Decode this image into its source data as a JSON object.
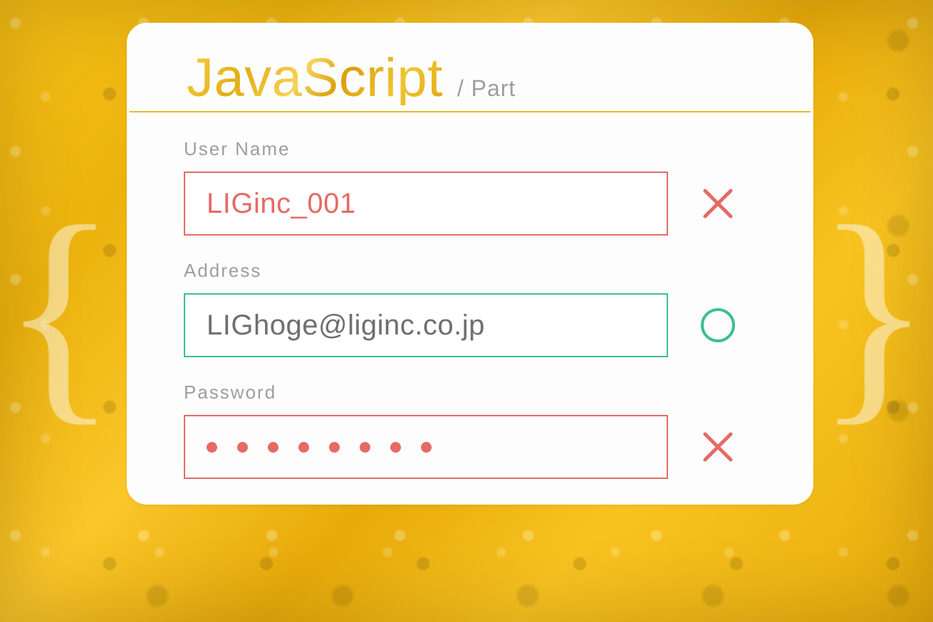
{
  "header": {
    "title": "JavaScript",
    "subtitle": "/ Part"
  },
  "form": {
    "username": {
      "label": "User Name",
      "value": "LIGinc_001",
      "status": "error"
    },
    "address": {
      "label": "Address",
      "value": "LIGhoge@liginc.co.jp",
      "status": "ok"
    },
    "password": {
      "label": "Password",
      "dot_count": 8,
      "status": "error"
    }
  },
  "colors": {
    "accent_gold": "#e9b92a",
    "error": "#e56a66",
    "ok": "#3dbf8f",
    "label_gray": "#9e9e9e"
  },
  "decor": {
    "brace_left": "{",
    "brace_right": "}"
  }
}
